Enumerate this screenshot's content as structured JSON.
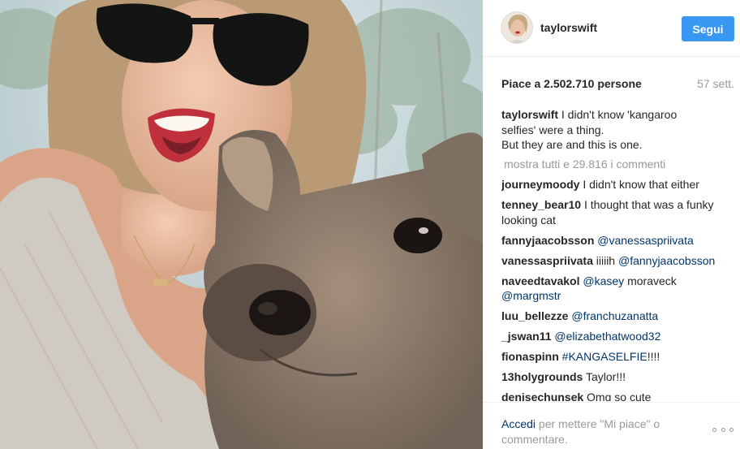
{
  "post": {
    "image_alt": "Selfie with kangaroo",
    "account": {
      "username": "taylorswift",
      "follow_label": "Segui",
      "avatar_icon": "profile-avatar"
    },
    "likes_text": "Piace a 2.502.710 persone",
    "age": "57 sett.",
    "caption": {
      "author": "taylorswift",
      "line1": "I didn't know 'kangaroo",
      "line2": "selfies' were a thing.",
      "line3": "But they are and this is one."
    },
    "show_all_comments": "mostra tutti e 29.816 i commenti",
    "comments": [
      {
        "author": "journeymoody",
        "text": "I didn't know that either",
        "mention": "",
        "suffix": ""
      },
      {
        "author": "tenney_bear10",
        "text": "I thought that was a funky looking cat",
        "mention": "",
        "suffix": ""
      },
      {
        "author": "fannyjaacobsson",
        "text": "",
        "mention": "@vanessaspriivata",
        "suffix": ""
      },
      {
        "author": "vanessaspriivata",
        "text": "iiiiih",
        "mention": "@fannyjaacobsson",
        "suffix": ""
      },
      {
        "author": "naveedtavakol",
        "text": "",
        "mention": "@kasey",
        "suffix": "moraveck",
        "mention2": "@margmstr"
      },
      {
        "author": "luu_bellezze",
        "text": "",
        "mention": "@franchuzanatta",
        "suffix": ""
      },
      {
        "author": "_jswan11",
        "text": "",
        "mention": "@elizabethatwood32",
        "suffix": ""
      },
      {
        "author": "fionaspinn",
        "text": "",
        "mention": "#KANGASELFIE",
        "suffix": "!!!!"
      },
      {
        "author": "13holygrounds",
        "text": "Taylor!!!",
        "mention": "",
        "suffix": ""
      },
      {
        "author": "denisechunsek",
        "text": "Omg so cute",
        "mention": "",
        "suffix": ""
      }
    ],
    "footer": {
      "login_link": "Accedi",
      "prompt_text": "per mettere \"Mi piace\" o commentare.",
      "more_icon": "more-options-icon"
    }
  },
  "colors": {
    "follow_button": "#3897f0",
    "link": "#003569",
    "muted": "#999999",
    "text": "#262626"
  }
}
